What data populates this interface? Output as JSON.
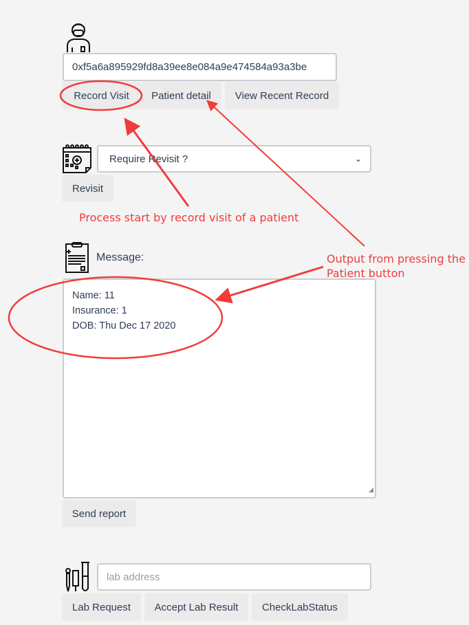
{
  "patient_section": {
    "icon": "doctor-mask-icon",
    "address_value": "0xf5a6a895929fd8a39ee8e084a9e474584a93a3be",
    "buttons": [
      "Record Visit",
      "Patient detail",
      "View Recent Record"
    ]
  },
  "revisit_section": {
    "icon": "calendar-medical-icon",
    "select_value": "Require Revisit ?",
    "button": "Revisit"
  },
  "message_section": {
    "icon": "clipboard-medical-icon",
    "label": "Message:",
    "lines": [
      "Name: 11",
      "Insurance: 1",
      "DOB: Thu Dec 17 2020"
    ],
    "button": "Send report"
  },
  "lab_section": {
    "icon": "test-tubes-icon",
    "placeholder": "lab address",
    "buttons": [
      "Lab Request",
      "Accept Lab Result",
      "CheckLabStatus"
    ]
  },
  "annotations": {
    "color": "#f03c3c",
    "process_note": "Process start by record visit of a patient",
    "output_note_line1": "Output from pressing the",
    "output_note_line2": "Patient button"
  }
}
